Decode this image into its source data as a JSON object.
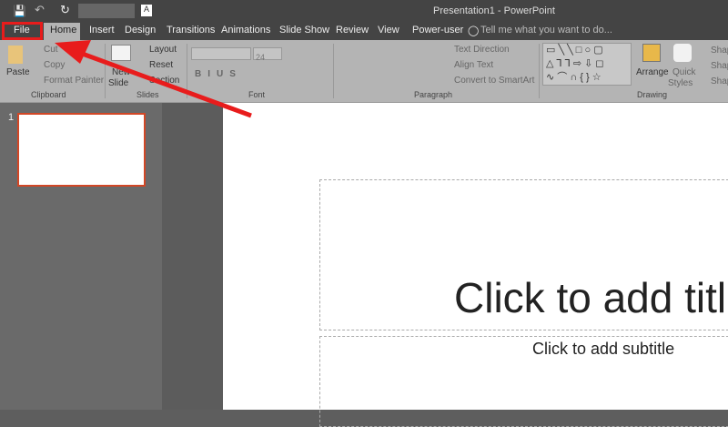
{
  "window_title": "Presentation1 - PowerPoint",
  "qat": {
    "font_box": "A"
  },
  "tabs": [
    {
      "label": "File"
    },
    {
      "label": "Home"
    },
    {
      "label": "Insert"
    },
    {
      "label": "Design"
    },
    {
      "label": "Transitions"
    },
    {
      "label": "Animations"
    },
    {
      "label": "Slide Show"
    },
    {
      "label": "Review"
    },
    {
      "label": "View"
    },
    {
      "label": "Power-user"
    }
  ],
  "tell_me": "Tell me what you want to do...",
  "clipboard": {
    "paste": "Paste",
    "cut": "Cut",
    "copy": "Copy",
    "format_painter": "Format Painter",
    "label": "Clipboard"
  },
  "slides": {
    "new1": "New",
    "new2": "Slide",
    "layout": "Layout",
    "reset": "Reset",
    "section": "Section",
    "label": "Slides"
  },
  "font": {
    "size": "24",
    "label": "Font"
  },
  "paragraph": {
    "text_direction": "Text Direction",
    "align_text": "Align Text",
    "convert": "Convert to SmartArt",
    "label": "Paragraph"
  },
  "drawing": {
    "arrange": "Arrange",
    "quick1": "Quick",
    "quick2": "Styles",
    "shape": "Shap",
    "label": "Drawing"
  },
  "thumb_number": "1",
  "slide": {
    "title": "Click to add title",
    "subtitle": "Click to add subtitle"
  },
  "colors": {
    "highlight": "#e81c1c"
  }
}
